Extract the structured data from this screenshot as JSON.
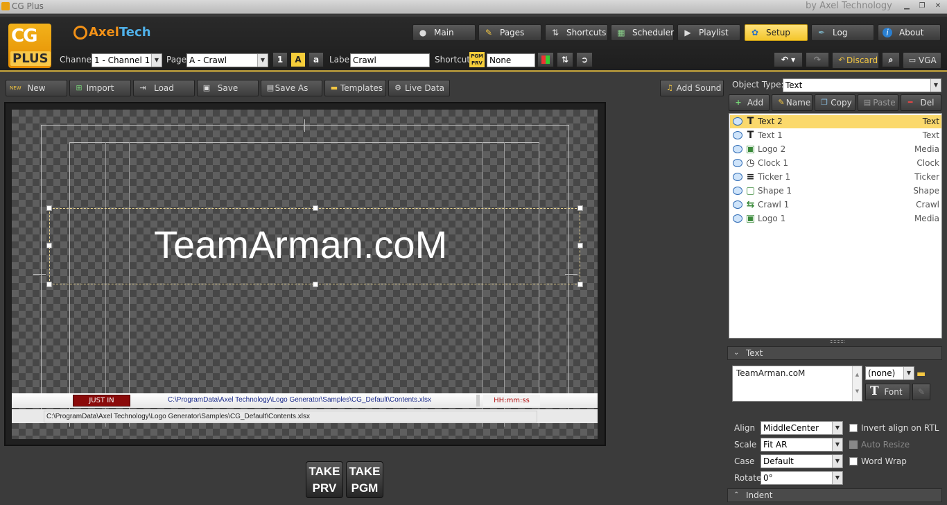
{
  "window": {
    "title": "CG Plus",
    "vendor": "by Axel Technology"
  },
  "brand": {
    "logo_top": "CG",
    "logo_bottom": "PLUS",
    "company_a": "Axel",
    "company_b": "Tech"
  },
  "nav": [
    {
      "label": "Main",
      "icon": "mouse-icon"
    },
    {
      "label": "Pages",
      "icon": "pencil-icon"
    },
    {
      "label": "Shortcuts",
      "icon": "arrows-icon"
    },
    {
      "label": "Scheduler",
      "icon": "grid-icon"
    },
    {
      "label": "Playlist",
      "icon": "play-icon"
    },
    {
      "label": "Setup",
      "icon": "gear-icon",
      "active": true
    },
    {
      "label": "Log",
      "icon": "log-icon"
    },
    {
      "label": "About",
      "icon": "info-icon"
    }
  ],
  "controls": {
    "channel_label": "Channel",
    "channel_value": "1 - Channel 1",
    "page_label": "Page",
    "page_value": "A - Crawl",
    "case_btns": [
      "1",
      "A",
      "a"
    ],
    "label_label": "Label",
    "label_value": "Crawl",
    "shortcut_label": "Shortcut",
    "pgm": "PGM",
    "prv": "PRV",
    "shortcut_value": "None",
    "discard": "Discard",
    "vga": "VGA"
  },
  "toolbar": [
    "New",
    "Import",
    "Load",
    "Save",
    "Save As",
    "Templates",
    "Live Data"
  ],
  "add_sound": "Add Sound",
  "canvas": {
    "main_text": "TeamArman.coM",
    "justin": "JUST IN",
    "crawl_text": "C:\\ProgramData\\Axel Technology\\Logo Generator\\Samples\\CG_Default\\Contents.xlsx",
    "clock_text": "HH:mm:ss",
    "ticker_text": "C:\\ProgramData\\Axel Technology\\Logo Generator\\Samples\\CG_Default\\Contents.xlsx"
  },
  "take": [
    {
      "a": "TAKE",
      "b": "PRV"
    },
    {
      "a": "TAKE",
      "b": "PGM"
    }
  ],
  "objects_panel": {
    "type_label": "Object Type:",
    "type_value": "Text",
    "buttons": [
      "Add",
      "Name",
      "Copy",
      "Paste",
      "Del"
    ],
    "items": [
      {
        "name": "Text 2",
        "type": "Text",
        "icon": "T",
        "selected": true
      },
      {
        "name": "Text 1",
        "type": "Text",
        "icon": "T"
      },
      {
        "name": "Logo 2",
        "type": "Media",
        "icon": "▣"
      },
      {
        "name": "Clock 1",
        "type": "Clock",
        "icon": "◷"
      },
      {
        "name": "Ticker 1",
        "type": "Ticker",
        "icon": "≡"
      },
      {
        "name": "Shape 1",
        "type": "Shape",
        "icon": "▢"
      },
      {
        "name": "Crawl 1",
        "type": "Crawl",
        "icon": "⇆"
      },
      {
        "name": "Logo 1",
        "type": "Media",
        "icon": "▣"
      }
    ]
  },
  "text_panel": {
    "header": "Text",
    "text_value": "TeamArman.coM",
    "style_value": "(none)",
    "font_btn": "Font",
    "align_label": "Align",
    "align_value": "MiddleCenter",
    "invert": "Invert align on RTL",
    "scale_label": "Scale",
    "scale_value": "Fit AR",
    "auto_resize": "Auto Resize",
    "case_label": "Case",
    "case_value": "Default",
    "word_wrap": "Word Wrap",
    "rotate_label": "Rotate",
    "rotate_value": "0°",
    "indent_header": "Indent"
  }
}
